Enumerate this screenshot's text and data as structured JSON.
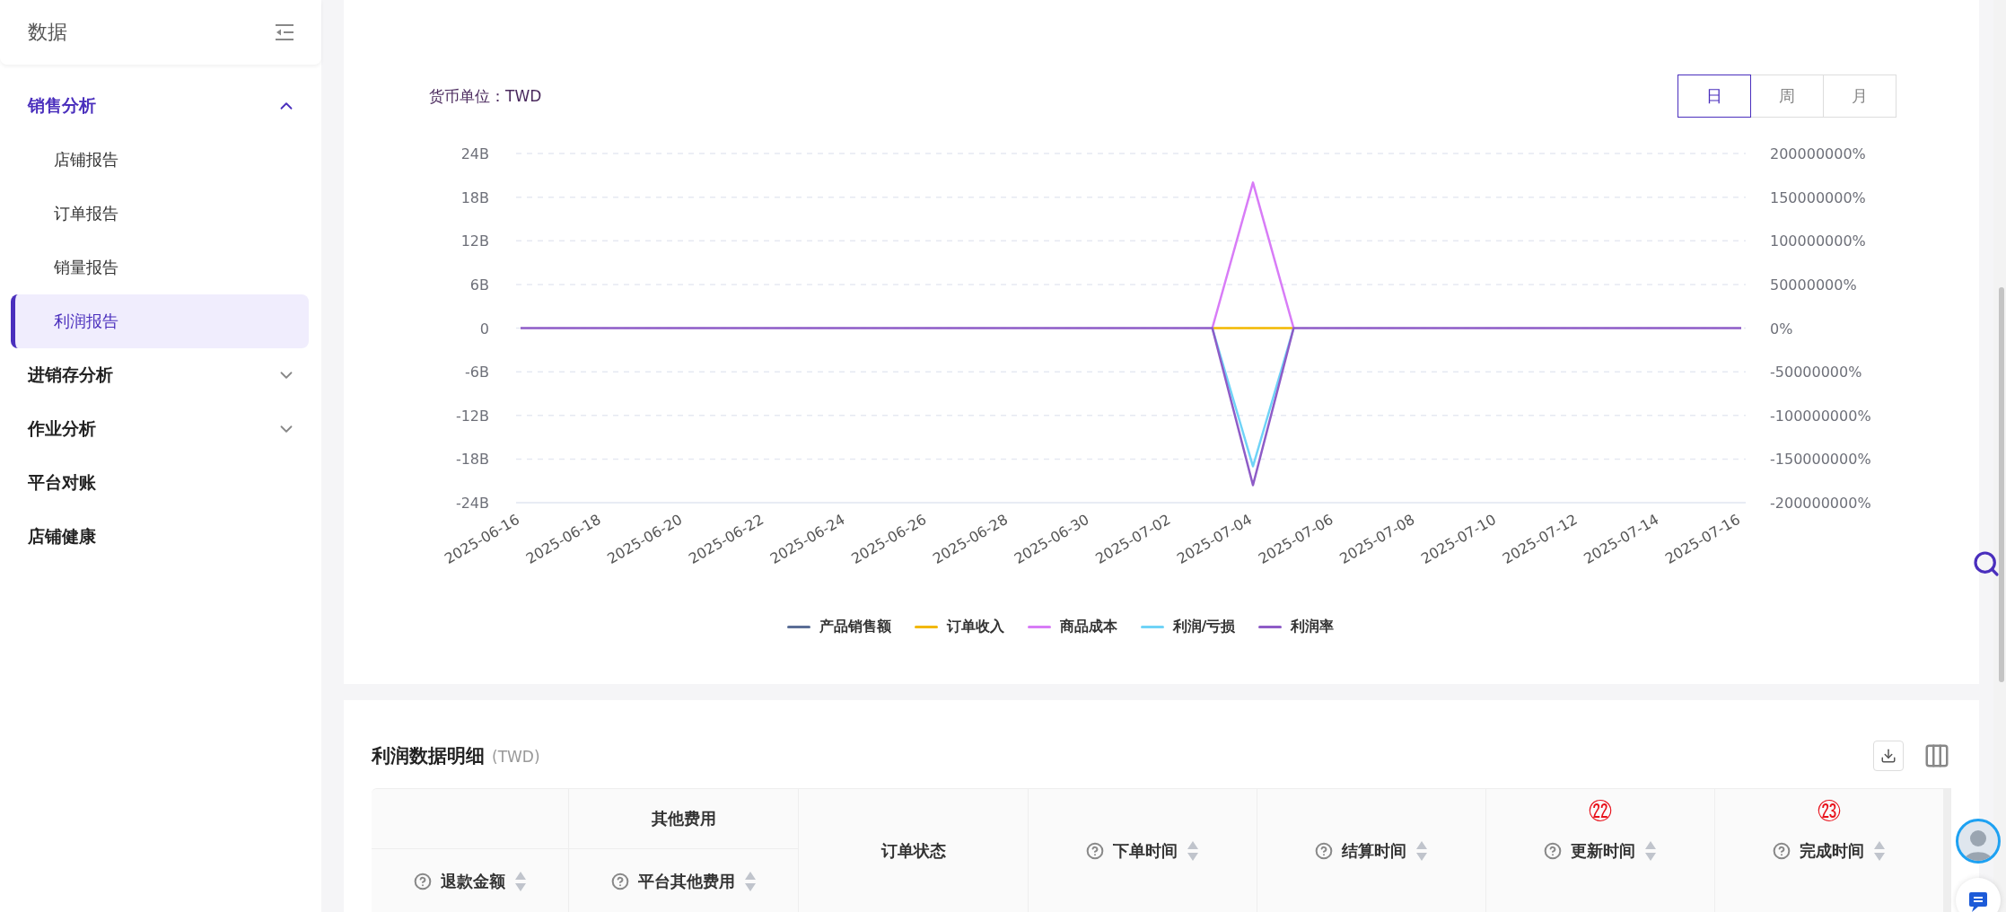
{
  "sidebar": {
    "title": "数据",
    "items": [
      {
        "kind": "group",
        "label": "销售分析",
        "expanded": true,
        "children": [
          {
            "label": "店铺报告",
            "selected": false
          },
          {
            "label": "订单报告",
            "selected": false
          },
          {
            "label": "销量报告",
            "selected": false
          },
          {
            "label": "利润报告",
            "selected": true
          }
        ]
      },
      {
        "kind": "group",
        "label": "进销存分析",
        "expanded": false
      },
      {
        "kind": "group",
        "label": "作业分析",
        "expanded": false
      },
      {
        "kind": "link",
        "label": "平台对账"
      },
      {
        "kind": "link",
        "label": "店铺健康"
      }
    ]
  },
  "chart": {
    "currency_label": "货币单位：TWD",
    "periods": [
      {
        "label": "日",
        "selected": true
      },
      {
        "label": "周",
        "selected": false
      },
      {
        "label": "月",
        "selected": false
      }
    ],
    "chart_data": {
      "type": "line",
      "categories": [
        "2025-06-16",
        null,
        "2025-06-18",
        null,
        "2025-06-20",
        null,
        "2025-06-22",
        null,
        "2025-06-24",
        null,
        "2025-06-26",
        null,
        "2025-06-28",
        null,
        "2025-06-30",
        null,
        "2025-07-02",
        null,
        "2025-07-04",
        null,
        "2025-07-06",
        null,
        "2025-07-08",
        null,
        "2025-07-10",
        null,
        "2025-07-12",
        null,
        "2025-07-14",
        null,
        "2025-07-16"
      ],
      "grid": true,
      "legend": true,
      "ylim": [
        -24000000000,
        24000000000
      ],
      "yticks": [
        {
          "value": 24000000000,
          "label": "24B"
        },
        {
          "value": 18000000000,
          "label": "18B"
        },
        {
          "value": 12000000000,
          "label": "12B"
        },
        {
          "value": 6000000000,
          "label": "6B"
        },
        {
          "value": 0,
          "label": "0"
        },
        {
          "value": -6000000000,
          "label": "-6B"
        },
        {
          "value": -12000000000,
          "label": "-12B"
        },
        {
          "value": -18000000000,
          "label": "-18B"
        },
        {
          "value": -24000000000,
          "label": "-24B"
        }
      ],
      "y2lim": [
        -200000000,
        200000000
      ],
      "y2ticks": [
        {
          "value": 200000000,
          "label": "200000000%"
        },
        {
          "value": 150000000,
          "label": "150000000%"
        },
        {
          "value": 100000000,
          "label": "100000000%"
        },
        {
          "value": 50000000,
          "label": "50000000%"
        },
        {
          "value": 0,
          "label": "0%"
        },
        {
          "value": -50000000,
          "label": "-50000000%"
        },
        {
          "value": -100000000,
          "label": "-100000000%"
        },
        {
          "value": -150000000,
          "label": "-150000000%"
        },
        {
          "value": -200000000,
          "label": "-200000000%"
        }
      ],
      "series": [
        {
          "name": "产品销售额",
          "color": "#5b6e96",
          "values": [
            null,
            null,
            null,
            null,
            null,
            null,
            null,
            null,
            null,
            null,
            null,
            null,
            null,
            null,
            null,
            null,
            null,
            null,
            null,
            null,
            null,
            null,
            null,
            null,
            null,
            null,
            null,
            null,
            null,
            null,
            null
          ]
        },
        {
          "name": "订单收入",
          "color": "#f2b800",
          "values": [
            null,
            null,
            null,
            null,
            null,
            null,
            null,
            null,
            null,
            null,
            null,
            null,
            null,
            null,
            null,
            null,
            null,
            0,
            0,
            0,
            null,
            null,
            null,
            null,
            null,
            null,
            null,
            null,
            null,
            null,
            null
          ]
        },
        {
          "name": "商品成本",
          "color": "#d87cf7",
          "values": [
            null,
            null,
            null,
            null,
            null,
            null,
            null,
            null,
            null,
            null,
            null,
            null,
            null,
            null,
            null,
            null,
            null,
            0,
            20000000000,
            0,
            null,
            null,
            null,
            null,
            null,
            null,
            null,
            null,
            null,
            null,
            null
          ]
        },
        {
          "name": "利润/亏损",
          "color": "#6fd3f7",
          "values": [
            null,
            null,
            null,
            null,
            null,
            null,
            null,
            null,
            null,
            null,
            null,
            null,
            null,
            null,
            null,
            null,
            null,
            0,
            -19000000000,
            0,
            null,
            null,
            null,
            null,
            null,
            null,
            null,
            null,
            null,
            null,
            null
          ]
        },
        {
          "name": "利润率",
          "color": "#8e5cc7",
          "axis": "y2",
          "values": [
            0,
            0,
            0,
            0,
            0,
            0,
            0,
            0,
            0,
            0,
            0,
            0,
            0,
            0,
            0,
            0,
            0,
            0,
            -180000000,
            0,
            0,
            0,
            0,
            0,
            0,
            0,
            0,
            0,
            0,
            0,
            0
          ]
        }
      ]
    }
  },
  "table": {
    "title": "利润数据明细",
    "unit": "(TWD)",
    "header": [
      {
        "kind": "group",
        "columns": [
          {
            "label": "退款金额",
            "help": true,
            "sortable": true
          }
        ]
      },
      {
        "kind": "group",
        "label": "其他费用",
        "columns": [
          {
            "label": "平台其他费用",
            "help": true,
            "sortable": true
          }
        ]
      },
      {
        "kind": "single",
        "label": "订单状态",
        "help": false,
        "sortable": false
      },
      {
        "kind": "single",
        "label": "下单时间",
        "help": true,
        "sortable": true
      },
      {
        "kind": "single",
        "label": "结算时间",
        "help": true,
        "sortable": true
      },
      {
        "kind": "single",
        "label": "更新时间",
        "help": true,
        "sortable": true,
        "annotation": "㉒"
      },
      {
        "kind": "single",
        "label": "完成时间",
        "help": true,
        "sortable": true,
        "annotation": "㉓"
      }
    ]
  }
}
